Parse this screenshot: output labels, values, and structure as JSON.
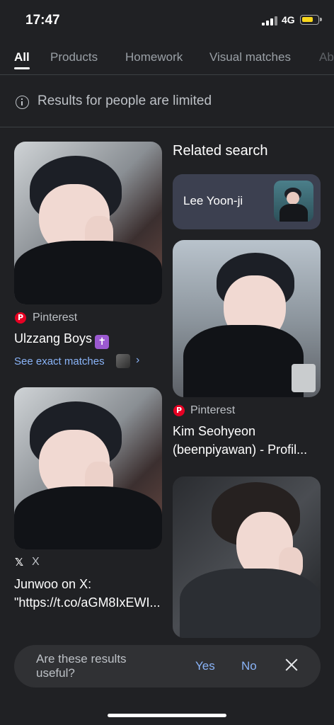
{
  "status_bar": {
    "time": "17:47",
    "network": "4G"
  },
  "tabs": [
    {
      "label": "All",
      "active": true
    },
    {
      "label": "Products"
    },
    {
      "label": "Homework"
    },
    {
      "label": "Visual matches"
    },
    {
      "label": "Ab"
    }
  ],
  "notice": {
    "text": "Results for people are limited",
    "icon": "info-icon"
  },
  "results_left": [
    {
      "source": "Pinterest",
      "source_icon": "pinterest-icon",
      "title": "Ulzzang Boys",
      "emoji": "✝",
      "see_exact": "See exact matches"
    },
    {
      "source": "X",
      "source_icon": "x-icon",
      "title": "Junwoo on X:",
      "title_line2": "\"https://t.co/aGM8IxEWI..."
    }
  ],
  "related": {
    "heading": "Related search",
    "chip_label": "Lee Yoon-ji"
  },
  "results_right": [
    {
      "source": "Pinterest",
      "source_icon": "pinterest-icon",
      "title": "Kim Seohyeon",
      "title_line2": "(beenpiyawan) - Profil..."
    }
  ],
  "feedback": {
    "question": "Are these results useful?",
    "yes": "Yes",
    "no": "No"
  },
  "colors": {
    "background": "#202124",
    "accent": "#8ab4f8",
    "pinterest": "#e60023"
  }
}
